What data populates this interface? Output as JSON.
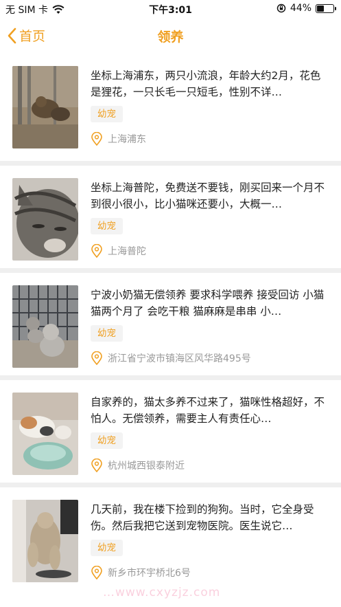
{
  "status_bar": {
    "carrier": "无 SIM 卡",
    "time": "下午3:01",
    "battery_percent": "44%",
    "battery_level": 0.44
  },
  "nav": {
    "back_label": "首页",
    "title": "领养"
  },
  "listings": [
    {
      "description": "坐标上海浦东，两只小流浪，年龄大约2月，花色是狸花，一只长毛一只短毛，性别不详…",
      "tag": "幼宠",
      "location": "上海浦东"
    },
    {
      "description": "坐标上海普陀，免费送不要钱，刚买回来一个月不到很小很小，比小猫咪还要小，大概一…",
      "tag": "幼宠",
      "location": "上海普陀"
    },
    {
      "description": "宁波小奶猫无偿领养 要求科学喂养 接受回访 小猫猫两个月了 会吃干粮 猫麻麻是串串 小…",
      "tag": "幼宠",
      "location": "浙江省宁波市镇海区风华路495号"
    },
    {
      "description": "自家养的，猫太多养不过来了，猫咪性格超好，不怕人。无偿领养，需要主人有责任心…",
      "tag": "幼宠",
      "location": "杭州城西银泰附近"
    },
    {
      "description": "几天前，我在楼下捡到的狗狗。当时，它全身受伤。然后我把它送到宠物医院。医生说它…",
      "tag": "幼宠",
      "location": "新乡市环宇桥北6号"
    }
  ],
  "watermark": "…www.cxyzjz.com",
  "colors": {
    "accent": "#f0a022",
    "muted": "#999999",
    "divider": "#efefef"
  }
}
